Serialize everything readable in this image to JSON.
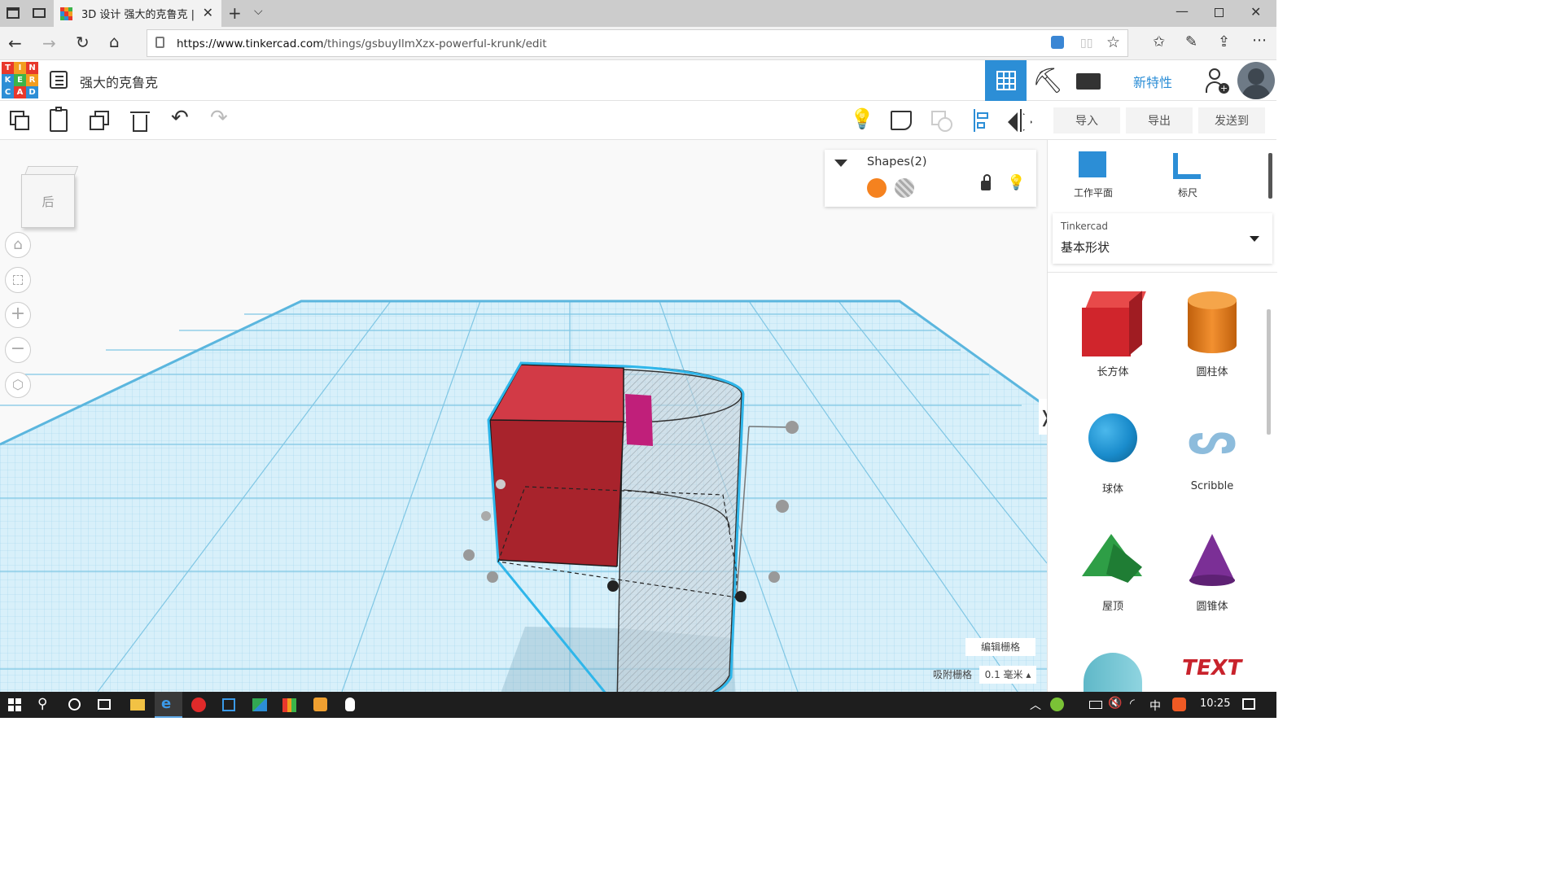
{
  "browser": {
    "tab_title": "3D 设计 强大的克鲁克 |",
    "url_host": "https://www.tinkercad.com",
    "url_path": "/things/gsbuyIlmXzx-powerful-krunk/edit"
  },
  "header": {
    "logo_letters": [
      "T",
      "I",
      "N",
      "K",
      "E",
      "R",
      "C",
      "A",
      "D"
    ],
    "design_name": "强大的克鲁克",
    "new_features": "新特性"
  },
  "toolbar": {
    "import": "导入",
    "export": "导出",
    "send_to": "发送到"
  },
  "shapes_panel": {
    "title": "Shapes(2)",
    "solid_color": "#f5821f"
  },
  "viewcube": {
    "face": "后"
  },
  "right_panel": {
    "workplane": "工作平面",
    "ruler": "标尺",
    "library_source": "Tinkercad",
    "library_name": "基本形状",
    "shapes": [
      {
        "name": "长方体"
      },
      {
        "name": "圆柱体"
      },
      {
        "name": "球体"
      },
      {
        "name": "Scribble"
      },
      {
        "name": "屋顶"
      },
      {
        "name": "圆锥体"
      }
    ]
  },
  "grid": {
    "edit_grid": "编辑栅格",
    "snap_grid_label": "吸附栅格",
    "snap_grid_value": "0.1 毫米 ▴"
  },
  "taskbar": {
    "time": "10:25",
    "ime": "中"
  },
  "colors": {
    "accent": "#2c8ed6",
    "grid_blue": "#a7daf0",
    "box_red": "#c8232c",
    "cylinder_orange": "#e07b1a",
    "sphere_blue": "#1a8ccc",
    "roof_green": "#2ea046",
    "cone_purple": "#7b2f96"
  }
}
